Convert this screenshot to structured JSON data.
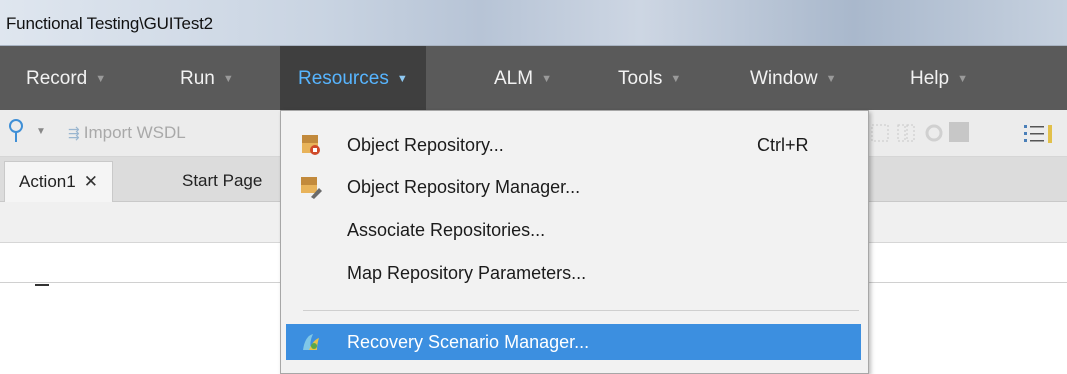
{
  "window": {
    "title": "Functional Testing\\GUITest2"
  },
  "menubar": {
    "items": [
      {
        "label": "Record"
      },
      {
        "label": "Run"
      },
      {
        "label": "Resources"
      },
      {
        "label": "ALM"
      },
      {
        "label": "Tools"
      },
      {
        "label": "Window"
      },
      {
        "label": "Help"
      }
    ],
    "active_item": "Resources"
  },
  "toolbar": {
    "import_label": "Import WSDL"
  },
  "tabs": [
    {
      "label": "Action1",
      "close": "✕",
      "active": true
    },
    {
      "label": "Start Page",
      "active": false
    }
  ],
  "resources_menu": {
    "items": [
      {
        "label": "Object Repository...",
        "shortcut": "Ctrl+R",
        "icon": "object-repository-icon"
      },
      {
        "label": "Object Repository Manager...",
        "icon": "object-repository-manager-icon"
      },
      {
        "label": "Associate Repositories..."
      },
      {
        "label": "Map Repository Parameters..."
      },
      {
        "label": "Recovery Scenario Manager...",
        "icon": "recovery-scenario-icon",
        "highlighted": true
      }
    ]
  },
  "colors": {
    "menubar_bg": "#5a5a5a",
    "menu_active_text": "#57b5ff",
    "highlight_bg": "#3c8fe0"
  }
}
